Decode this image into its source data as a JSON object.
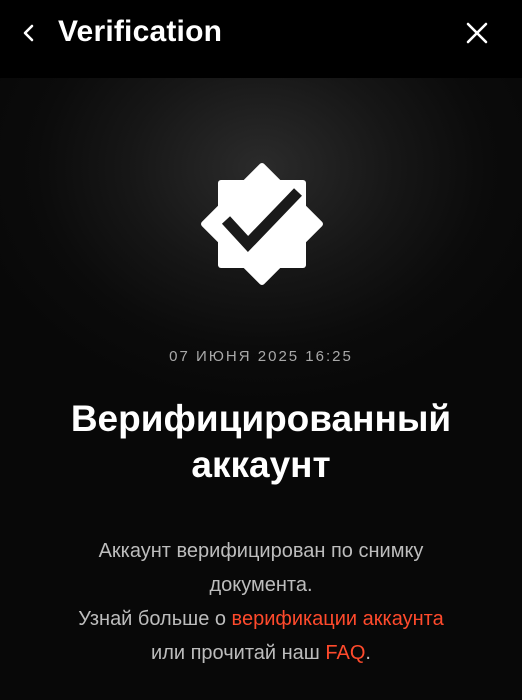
{
  "header": {
    "title": "Verification",
    "back_icon": "chevron-left-icon",
    "close_icon": "close-icon"
  },
  "badge": {
    "icon": "verified-badge-icon",
    "color": "#ffffff"
  },
  "main": {
    "date": "07 ИЮНЯ 2025 16:25",
    "heading_line1": "Верифицированный",
    "heading_line2": "аккаунт",
    "description_line1": "Аккаунт верифицирован по снимку",
    "description_line2": "документа.",
    "learn_more_prefix": "Узнай больше о ",
    "learn_more_link": "верификации аккаунта",
    "faq_prefix": "или прочитай наш ",
    "faq_link": "FAQ",
    "faq_suffix": "."
  },
  "colors": {
    "background": "#000000",
    "link": "#ff4a2c",
    "muted_text": "#bdbdbd"
  }
}
